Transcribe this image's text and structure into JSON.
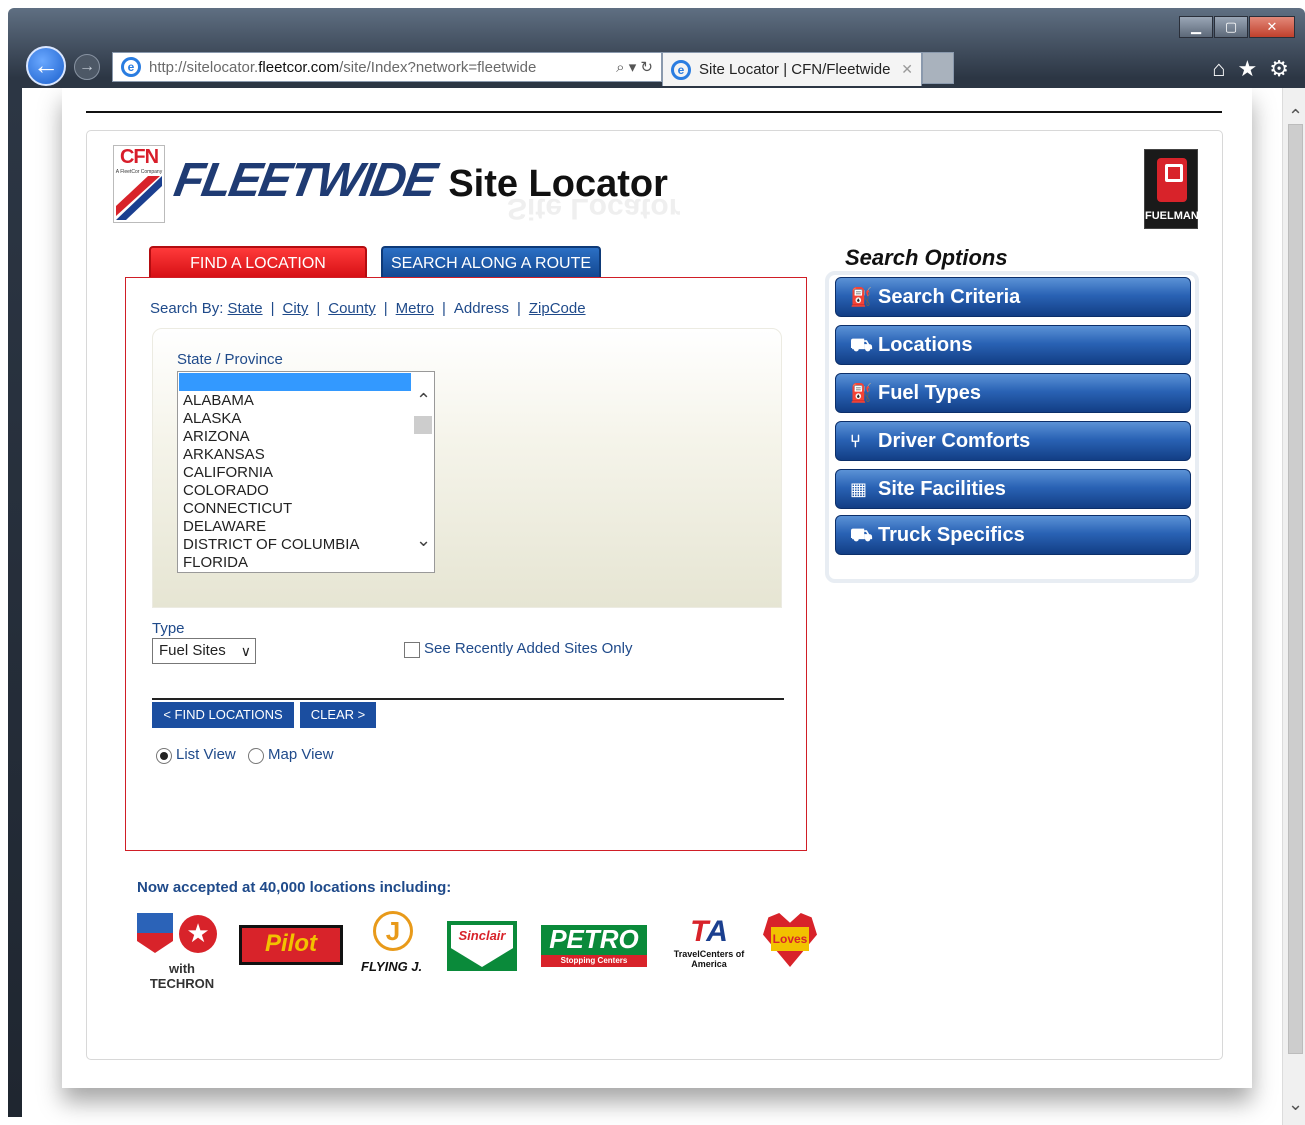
{
  "browser": {
    "url_prefix": "http://sitelocator.",
    "url_domain": "fleetcor.com",
    "url_suffix": "/site/Index?network=fleetwide",
    "tab_title": "Site Locator | CFN/Fleetwide",
    "addr_tools": "⌕ ▾ ↻"
  },
  "header": {
    "cfn": "CFN",
    "cfn_sub": "A FleetCor Company",
    "fleetwide": "FLEETWIDE",
    "site_locator": "Site Locator",
    "fuelman": "FUELMAN",
    "fuelman_sub": "NETWORK"
  },
  "tabs": {
    "find": "FIND A LOCATION",
    "route": "SEARCH ALONG A ROUTE"
  },
  "search": {
    "search_by_label": "Search By:",
    "options": {
      "state": "State",
      "city": "City",
      "county": "County",
      "metro": "Metro",
      "address": "Address",
      "zipcode": "ZipCode"
    },
    "state_label": "State / Province",
    "states": [
      "ALABAMA",
      "ALASKA",
      "ARIZONA",
      "ARKANSAS",
      "CALIFORNIA",
      "COLORADO",
      "CONNECTICUT",
      "DELAWARE",
      "DISTRICT OF COLUMBIA",
      "FLORIDA"
    ],
    "type_label": "Type",
    "type_value": "Fuel Sites",
    "recent_label": "See Recently Added Sites Only",
    "find_btn": "< FIND LOCATIONS",
    "clear_btn": "CLEAR >",
    "list_view": "List View",
    "map_view": "Map View",
    "selected_view": "list"
  },
  "options_panel": {
    "heading": "Search Options",
    "items": [
      {
        "label": "Search Criteria",
        "icon": "fuel-pump-icon"
      },
      {
        "label": "Locations",
        "icon": "truck-icon"
      },
      {
        "label": "Fuel Types",
        "icon": "fuel-pump-icon"
      },
      {
        "label": "Driver Comforts",
        "icon": "utensils-icon"
      },
      {
        "label": "Site Facilities",
        "icon": "building-icon"
      },
      {
        "label": "Truck Specifics",
        "icon": "truck-icon"
      }
    ]
  },
  "partners": {
    "title": "Now accepted at 40,000 locations including:",
    "chevron": "Chevron",
    "techron": "with TECHRON",
    "pilot": "Pilot",
    "flying_j": "FLYING J.",
    "sinclair": "Sinclair",
    "petro": "PETRO",
    "petro_sub": "Stopping Centers",
    "ta": "TA",
    "ta_sub": "TravelCenters of America",
    "loves": "Loves"
  },
  "colors": {
    "brand_red": "#d8232a",
    "brand_blue": "#1b4ea0",
    "link_blue": "#1f4a8a"
  }
}
